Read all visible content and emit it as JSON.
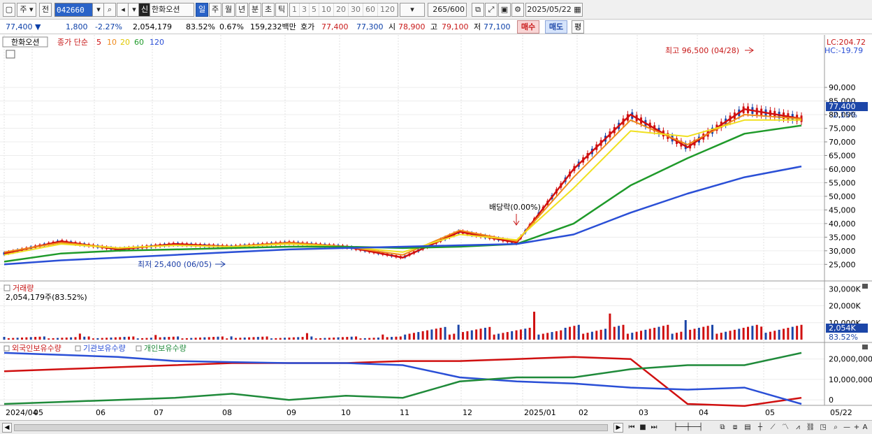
{
  "toolbar": {
    "market": "주",
    "prev_label": "전",
    "code": "042660",
    "name_badge": "신",
    "name": "한화오션",
    "periods": [
      "일",
      "주",
      "월",
      "년",
      "분",
      "초",
      "틱"
    ],
    "active_period": "일",
    "intervals": [
      "1",
      "3",
      "5",
      "10",
      "20",
      "30",
      "60",
      "120"
    ],
    "count": "265",
    "count_total": "/600",
    "date": "2025/05/22"
  },
  "quote": {
    "price": "77,400",
    "change": "1,800",
    "change_pct": "-2.27%",
    "volume": "2,054,179",
    "volume_ratio": "83.52%",
    "turnover": "0.67%",
    "amount": "159,232백만",
    "ask_label": "호가",
    "ask": "77,400",
    "bid": "77,300",
    "open_label": "시",
    "open": "78,900",
    "high_label": "고",
    "high": "79,100",
    "low_label": "저",
    "low": "77,100",
    "buy": "매수",
    "sell": "매도",
    "eval": "평"
  },
  "price_panel": {
    "legend_name": "한화오션",
    "legend_type": "종가 단순",
    "ma_periods": [
      "5",
      "10",
      "20",
      "60",
      "120"
    ],
    "ma_colors": [
      "#d01010",
      "#f08a1a",
      "#f0e020",
      "#1f9a2a",
      "#2a4fd6"
    ],
    "lc": "LC:204.72",
    "hc": "HC:-19.79",
    "high_annotation": "최고 96,500 (04/28)",
    "low_annotation": "최저 25,400 (06/05)",
    "dividend_annotation": "배당락(0.00%)",
    "current_price_tag": "77,400",
    "current_change_tag": "-2.15%",
    "y_ticks": [
      "25,000",
      "30,000",
      "35,000",
      "40,000",
      "45,000",
      "50,000",
      "55,000",
      "60,000",
      "65,000",
      "70,000",
      "75,000",
      "80,000",
      "85,000",
      "90,000"
    ]
  },
  "volume_panel": {
    "title": "거래량",
    "value": "2,054,179주(83.52%)",
    "y_ticks": [
      "10,000K",
      "20,000K",
      "30,000K"
    ],
    "current_tag": "2,054K",
    "current_pct": "83.52%"
  },
  "holding_panel": {
    "legend": [
      "외국인보유수량",
      "기관보유수량",
      "개인보유수량"
    ],
    "colors": [
      "#d01010",
      "#2a4fd6",
      "#1f8a3a"
    ],
    "y_ticks": [
      "0",
      "10,000,000",
      "20,000,000"
    ]
  },
  "x_labels": [
    "2024/04",
    "05",
    "06",
    "07",
    "08",
    "09",
    "10",
    "11",
    "12",
    "2025/01",
    "02",
    "03",
    "04",
    "05",
    "05/22"
  ],
  "chart_data": {
    "type": "line",
    "x": [
      "2024-04",
      "2024-05",
      "2024-06",
      "2024-07",
      "2024-08",
      "2024-09",
      "2024-10",
      "2024-11",
      "2024-12",
      "2025-01",
      "2025-02",
      "2025-03",
      "2025-04",
      "2025-05",
      "2025-05-22"
    ],
    "series": [
      {
        "name": "5",
        "values": [
          29000,
          33500,
          30500,
          32500,
          31500,
          33000,
          31500,
          27500,
          37000,
          33000,
          60000,
          80000,
          68000,
          82000,
          78500
        ]
      },
      {
        "name": "10",
        "values": [
          29500,
          33000,
          31000,
          32000,
          31500,
          33000,
          31500,
          28500,
          37500,
          33500,
          57000,
          78000,
          69000,
          80000,
          78500
        ]
      },
      {
        "name": "20",
        "values": [
          28500,
          32500,
          31000,
          32000,
          31500,
          32500,
          31500,
          29500,
          36000,
          34000,
          53000,
          74000,
          72000,
          78000,
          78000
        ]
      },
      {
        "name": "60",
        "values": [
          26000,
          29000,
          30000,
          30500,
          31000,
          31500,
          31500,
          31000,
          31500,
          32500,
          40000,
          54000,
          64000,
          73000,
          76000
        ]
      },
      {
        "name": "120",
        "values": [
          25000,
          26500,
          27500,
          28500,
          29500,
          30500,
          31000,
          31500,
          32000,
          32500,
          36000,
          44000,
          51000,
          57000,
          61000
        ]
      }
    ],
    "ylim": [
      22000,
      99000
    ],
    "annotations": [
      "최고 96,500 (04/28)",
      "최저 25,400 (06/05)",
      "배당락(0.00%)"
    ]
  }
}
